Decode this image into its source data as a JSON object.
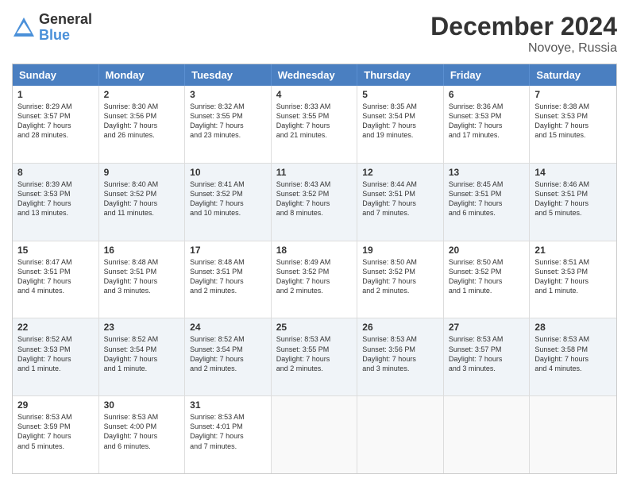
{
  "logo": {
    "general": "General",
    "blue": "Blue"
  },
  "title": "December 2024",
  "subtitle": "Novoye, Russia",
  "header_days": [
    "Sunday",
    "Monday",
    "Tuesday",
    "Wednesday",
    "Thursday",
    "Friday",
    "Saturday"
  ],
  "rows": [
    [
      {
        "day": "1",
        "lines": [
          "Sunrise: 8:29 AM",
          "Sunset: 3:57 PM",
          "Daylight: 7 hours",
          "and 28 minutes."
        ]
      },
      {
        "day": "2",
        "lines": [
          "Sunrise: 8:30 AM",
          "Sunset: 3:56 PM",
          "Daylight: 7 hours",
          "and 26 minutes."
        ]
      },
      {
        "day": "3",
        "lines": [
          "Sunrise: 8:32 AM",
          "Sunset: 3:55 PM",
          "Daylight: 7 hours",
          "and 23 minutes."
        ]
      },
      {
        "day": "4",
        "lines": [
          "Sunrise: 8:33 AM",
          "Sunset: 3:55 PM",
          "Daylight: 7 hours",
          "and 21 minutes."
        ]
      },
      {
        "day": "5",
        "lines": [
          "Sunrise: 8:35 AM",
          "Sunset: 3:54 PM",
          "Daylight: 7 hours",
          "and 19 minutes."
        ]
      },
      {
        "day": "6",
        "lines": [
          "Sunrise: 8:36 AM",
          "Sunset: 3:53 PM",
          "Daylight: 7 hours",
          "and 17 minutes."
        ]
      },
      {
        "day": "7",
        "lines": [
          "Sunrise: 8:38 AM",
          "Sunset: 3:53 PM",
          "Daylight: 7 hours",
          "and 15 minutes."
        ]
      }
    ],
    [
      {
        "day": "8",
        "lines": [
          "Sunrise: 8:39 AM",
          "Sunset: 3:53 PM",
          "Daylight: 7 hours",
          "and 13 minutes."
        ]
      },
      {
        "day": "9",
        "lines": [
          "Sunrise: 8:40 AM",
          "Sunset: 3:52 PM",
          "Daylight: 7 hours",
          "and 11 minutes."
        ]
      },
      {
        "day": "10",
        "lines": [
          "Sunrise: 8:41 AM",
          "Sunset: 3:52 PM",
          "Daylight: 7 hours",
          "and 10 minutes."
        ]
      },
      {
        "day": "11",
        "lines": [
          "Sunrise: 8:43 AM",
          "Sunset: 3:52 PM",
          "Daylight: 7 hours",
          "and 8 minutes."
        ]
      },
      {
        "day": "12",
        "lines": [
          "Sunrise: 8:44 AM",
          "Sunset: 3:51 PM",
          "Daylight: 7 hours",
          "and 7 minutes."
        ]
      },
      {
        "day": "13",
        "lines": [
          "Sunrise: 8:45 AM",
          "Sunset: 3:51 PM",
          "Daylight: 7 hours",
          "and 6 minutes."
        ]
      },
      {
        "day": "14",
        "lines": [
          "Sunrise: 8:46 AM",
          "Sunset: 3:51 PM",
          "Daylight: 7 hours",
          "and 5 minutes."
        ]
      }
    ],
    [
      {
        "day": "15",
        "lines": [
          "Sunrise: 8:47 AM",
          "Sunset: 3:51 PM",
          "Daylight: 7 hours",
          "and 4 minutes."
        ]
      },
      {
        "day": "16",
        "lines": [
          "Sunrise: 8:48 AM",
          "Sunset: 3:51 PM",
          "Daylight: 7 hours",
          "and 3 minutes."
        ]
      },
      {
        "day": "17",
        "lines": [
          "Sunrise: 8:48 AM",
          "Sunset: 3:51 PM",
          "Daylight: 7 hours",
          "and 2 minutes."
        ]
      },
      {
        "day": "18",
        "lines": [
          "Sunrise: 8:49 AM",
          "Sunset: 3:52 PM",
          "Daylight: 7 hours",
          "and 2 minutes."
        ]
      },
      {
        "day": "19",
        "lines": [
          "Sunrise: 8:50 AM",
          "Sunset: 3:52 PM",
          "Daylight: 7 hours",
          "and 2 minutes."
        ]
      },
      {
        "day": "20",
        "lines": [
          "Sunrise: 8:50 AM",
          "Sunset: 3:52 PM",
          "Daylight: 7 hours",
          "and 1 minute."
        ]
      },
      {
        "day": "21",
        "lines": [
          "Sunrise: 8:51 AM",
          "Sunset: 3:53 PM",
          "Daylight: 7 hours",
          "and 1 minute."
        ]
      }
    ],
    [
      {
        "day": "22",
        "lines": [
          "Sunrise: 8:52 AM",
          "Sunset: 3:53 PM",
          "Daylight: 7 hours",
          "and 1 minute."
        ]
      },
      {
        "day": "23",
        "lines": [
          "Sunrise: 8:52 AM",
          "Sunset: 3:54 PM",
          "Daylight: 7 hours",
          "and 1 minute."
        ]
      },
      {
        "day": "24",
        "lines": [
          "Sunrise: 8:52 AM",
          "Sunset: 3:54 PM",
          "Daylight: 7 hours",
          "and 2 minutes."
        ]
      },
      {
        "day": "25",
        "lines": [
          "Sunrise: 8:53 AM",
          "Sunset: 3:55 PM",
          "Daylight: 7 hours",
          "and 2 minutes."
        ]
      },
      {
        "day": "26",
        "lines": [
          "Sunrise: 8:53 AM",
          "Sunset: 3:56 PM",
          "Daylight: 7 hours",
          "and 3 minutes."
        ]
      },
      {
        "day": "27",
        "lines": [
          "Sunrise: 8:53 AM",
          "Sunset: 3:57 PM",
          "Daylight: 7 hours",
          "and 3 minutes."
        ]
      },
      {
        "day": "28",
        "lines": [
          "Sunrise: 8:53 AM",
          "Sunset: 3:58 PM",
          "Daylight: 7 hours",
          "and 4 minutes."
        ]
      }
    ],
    [
      {
        "day": "29",
        "lines": [
          "Sunrise: 8:53 AM",
          "Sunset: 3:59 PM",
          "Daylight: 7 hours",
          "and 5 minutes."
        ]
      },
      {
        "day": "30",
        "lines": [
          "Sunrise: 8:53 AM",
          "Sunset: 4:00 PM",
          "Daylight: 7 hours",
          "and 6 minutes."
        ]
      },
      {
        "day": "31",
        "lines": [
          "Sunrise: 8:53 AM",
          "Sunset: 4:01 PM",
          "Daylight: 7 hours",
          "and 7 minutes."
        ]
      },
      {
        "day": "",
        "lines": []
      },
      {
        "day": "",
        "lines": []
      },
      {
        "day": "",
        "lines": []
      },
      {
        "day": "",
        "lines": []
      }
    ]
  ],
  "alt_rows": [
    1,
    3
  ]
}
